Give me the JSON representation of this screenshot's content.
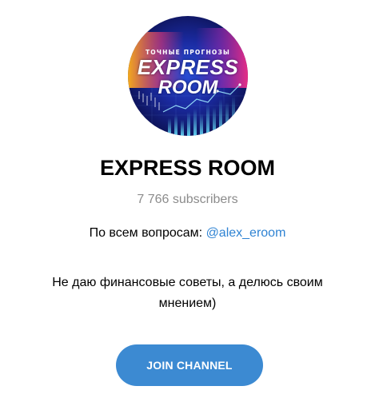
{
  "channel": {
    "avatar": {
      "tagline": "ТОЧНЫЕ ПРОГНОЗЫ",
      "logo_line1": "EXPRESS",
      "logo_line2": "ROOM"
    },
    "title": "EXPRESS ROOM",
    "subscribers": "7 766 subscribers",
    "description": {
      "line1_text": "По всем вопросам: ",
      "line1_link": "@alex_eroom",
      "line2": "Не даю финансовые советы, а делюсь своим",
      "line3": "мнением)"
    },
    "join_button_label": "JOIN CHANNEL"
  },
  "colors": {
    "accent": "#3c8ad2",
    "link": "#2f83d3",
    "muted": "#8c8c8c"
  }
}
